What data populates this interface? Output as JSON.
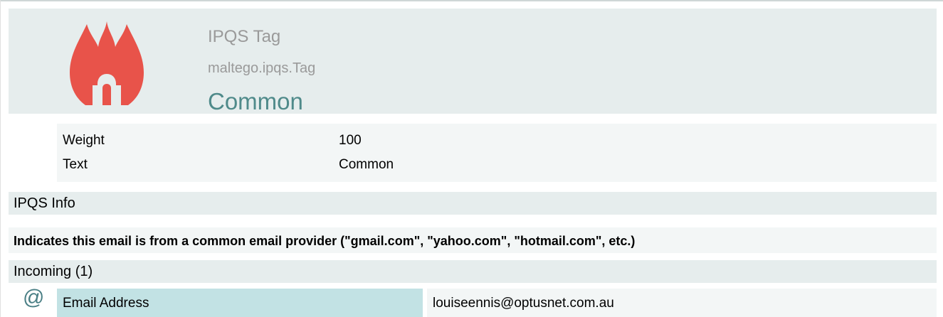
{
  "entity": {
    "type_name": "IPQS Tag",
    "type_id": "maltego.ipqs.Tag",
    "value": "Common",
    "icon": "flame-icon",
    "icon_color": "#e8534a"
  },
  "properties": [
    {
      "name": "Weight",
      "value": "100"
    },
    {
      "name": "Text",
      "value": "Common"
    }
  ],
  "info_section": {
    "title": "IPQS Info",
    "description": "Indicates this email is from a common email provider (\"gmail.com\", \"yahoo.com\", \"hotmail.com\", etc.)"
  },
  "incoming": {
    "title": "Incoming (1)",
    "links": [
      {
        "icon": "at-sign-icon",
        "type": "Email Address",
        "value": "louiseennis@optusnet.com.au"
      }
    ]
  },
  "colors": {
    "header_bg": "#e6eded",
    "value_text": "#4f8a8a",
    "link_type_bg": "#c2e2e4",
    "at_icon": "#4a7f85"
  }
}
